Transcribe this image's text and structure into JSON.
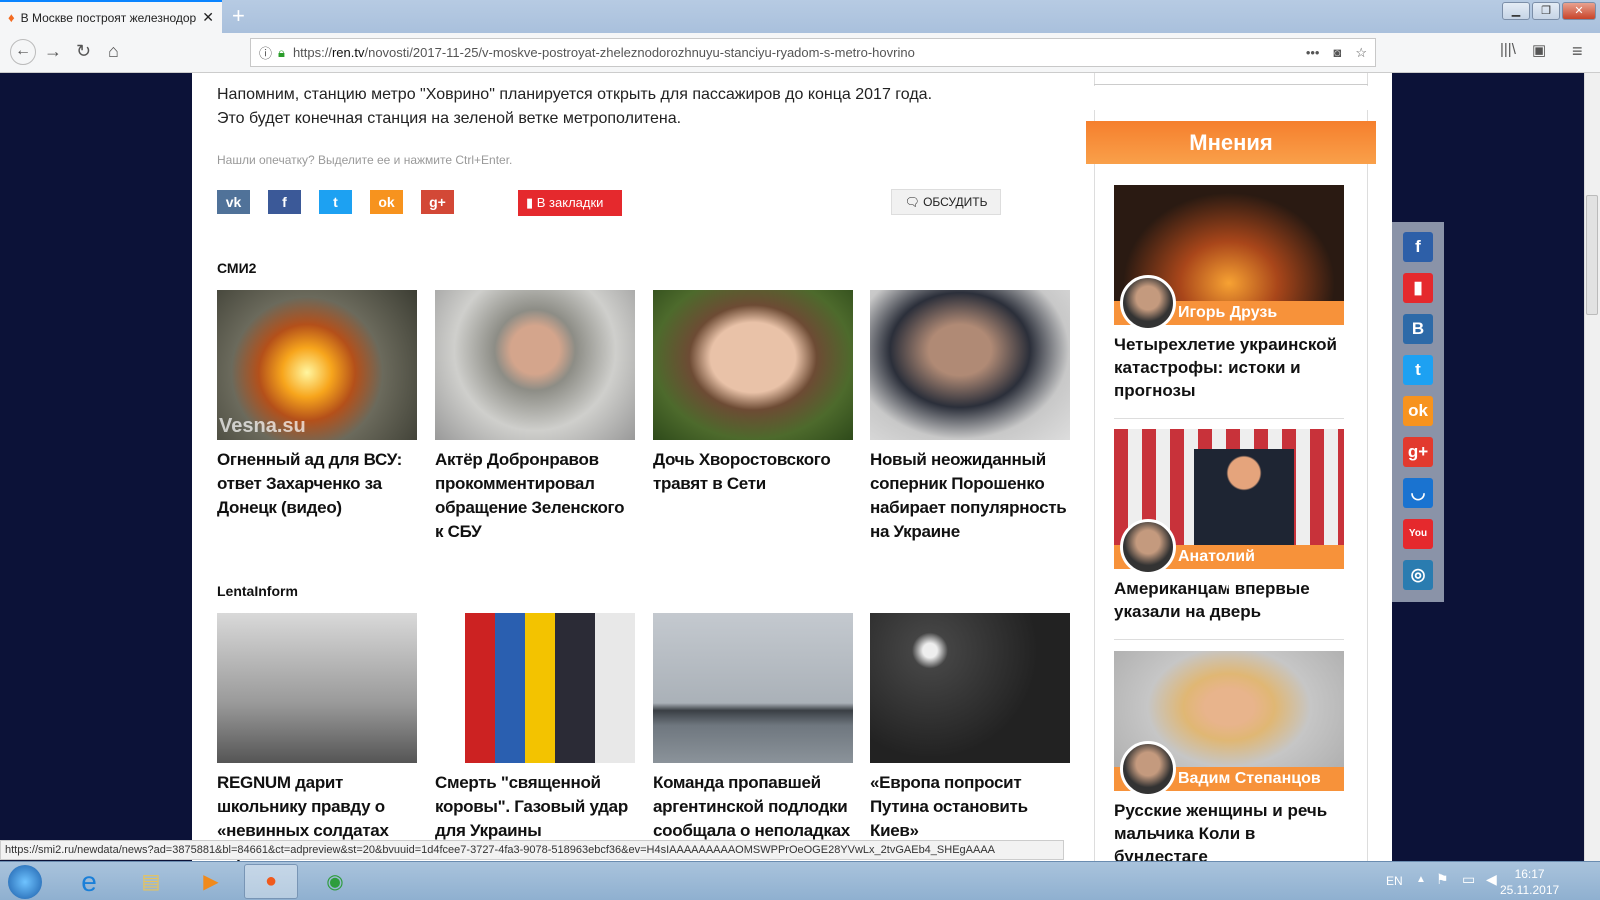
{
  "browser": {
    "tab_title": "В Москве построят железнодорожную",
    "url_prefix": "https://",
    "url_domain": "ren.tv",
    "url_path": "/novosti/2017-11-25/v-moskve-postroyat-zheleznodorozhnuyu-stanciyu-ryadom-s-metro-hovrino",
    "status_url": "https://smi2.ru/newdata/news?ad=3875881&bl=84661&ct=adpreview&st=20&bvuuid=1d4fcee7-3727-4fa3-9078-518963ebcf36&ev=H4sIAAAAAAAAAOMSWPPrOeOGE28YVwLx_2tvGAEb4_SHEgAAAA"
  },
  "article": {
    "paragraph": "Напомним, станцию метро \"Ховрино\" планируется открыть для пассажиров до конца 2017 года. Это будет конечная станция на зеленой ветке метрополитена.",
    "typo_note": "Нашли опечатку? Выделите ее и нажмите Ctrl+Enter.",
    "bookmark_label": "В закладки",
    "discuss_label": "ОБСУДИТЬ"
  },
  "smi2": {
    "heading": "СМИ2",
    "items": [
      {
        "title": "Огненный ад для ВСУ: ответ Захарченко за Донецк (видео)",
        "watermark": "Vesna.su"
      },
      {
        "title": "Актёр Добронравов прокомментировал обращение Зеленского к СБУ"
      },
      {
        "title": "Дочь Хворостовского травят в Сети"
      },
      {
        "title": "Новый неожиданный соперник Порошенко набирает популярность на Украине"
      }
    ]
  },
  "lentainform": {
    "heading": "LentaInform",
    "items": [
      {
        "title": "REGNUM дарит школьнику правду о «невинных солдатах вермахта»"
      },
      {
        "title": "Смерть \"священной коровы\". Газовый удар для Украины"
      },
      {
        "title": "Команда пропавшей аргентинской подлодки сообщала о неполадках"
      },
      {
        "title": "«Европа попросит Путина остановить Киев»"
      }
    ]
  },
  "opinions": {
    "heading": "Мнения",
    "items": [
      {
        "author": "Игорь Друзь",
        "title": "Четырехлетие украинской катастрофы: истоки и прогнозы"
      },
      {
        "author": "Анатолий Вассерман",
        "title": "Американцам впервые указали на дверь"
      },
      {
        "author": "Вадим Степанцов",
        "title": "Русские женщины и речь мальчика Коли в бундестаге"
      }
    ]
  },
  "taskbar": {
    "lang": "EN",
    "time": "16:17",
    "date": "25.11.2017"
  }
}
